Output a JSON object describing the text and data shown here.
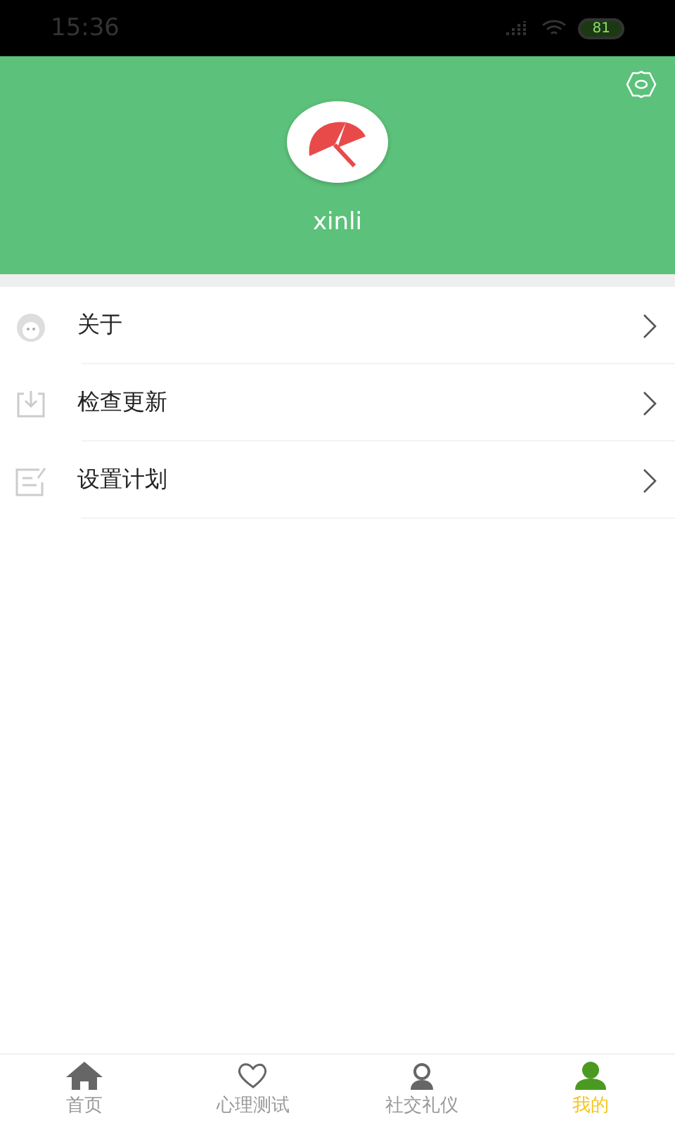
{
  "status_bar": {
    "time": "15:36",
    "battery": "81"
  },
  "profile": {
    "username": "xinli"
  },
  "menu": [
    {
      "kind": "about",
      "label": "关于"
    },
    {
      "kind": "update",
      "label": "检查更新"
    },
    {
      "kind": "plan",
      "label": "设置计划"
    }
  ],
  "tabs": [
    {
      "kind": "home",
      "label": "首页",
      "selected": false
    },
    {
      "kind": "heart",
      "label": "心理测试",
      "selected": false
    },
    {
      "kind": "person",
      "label": "社交礼仪",
      "selected": false
    },
    {
      "kind": "user",
      "label": "我的",
      "selected": true
    }
  ]
}
